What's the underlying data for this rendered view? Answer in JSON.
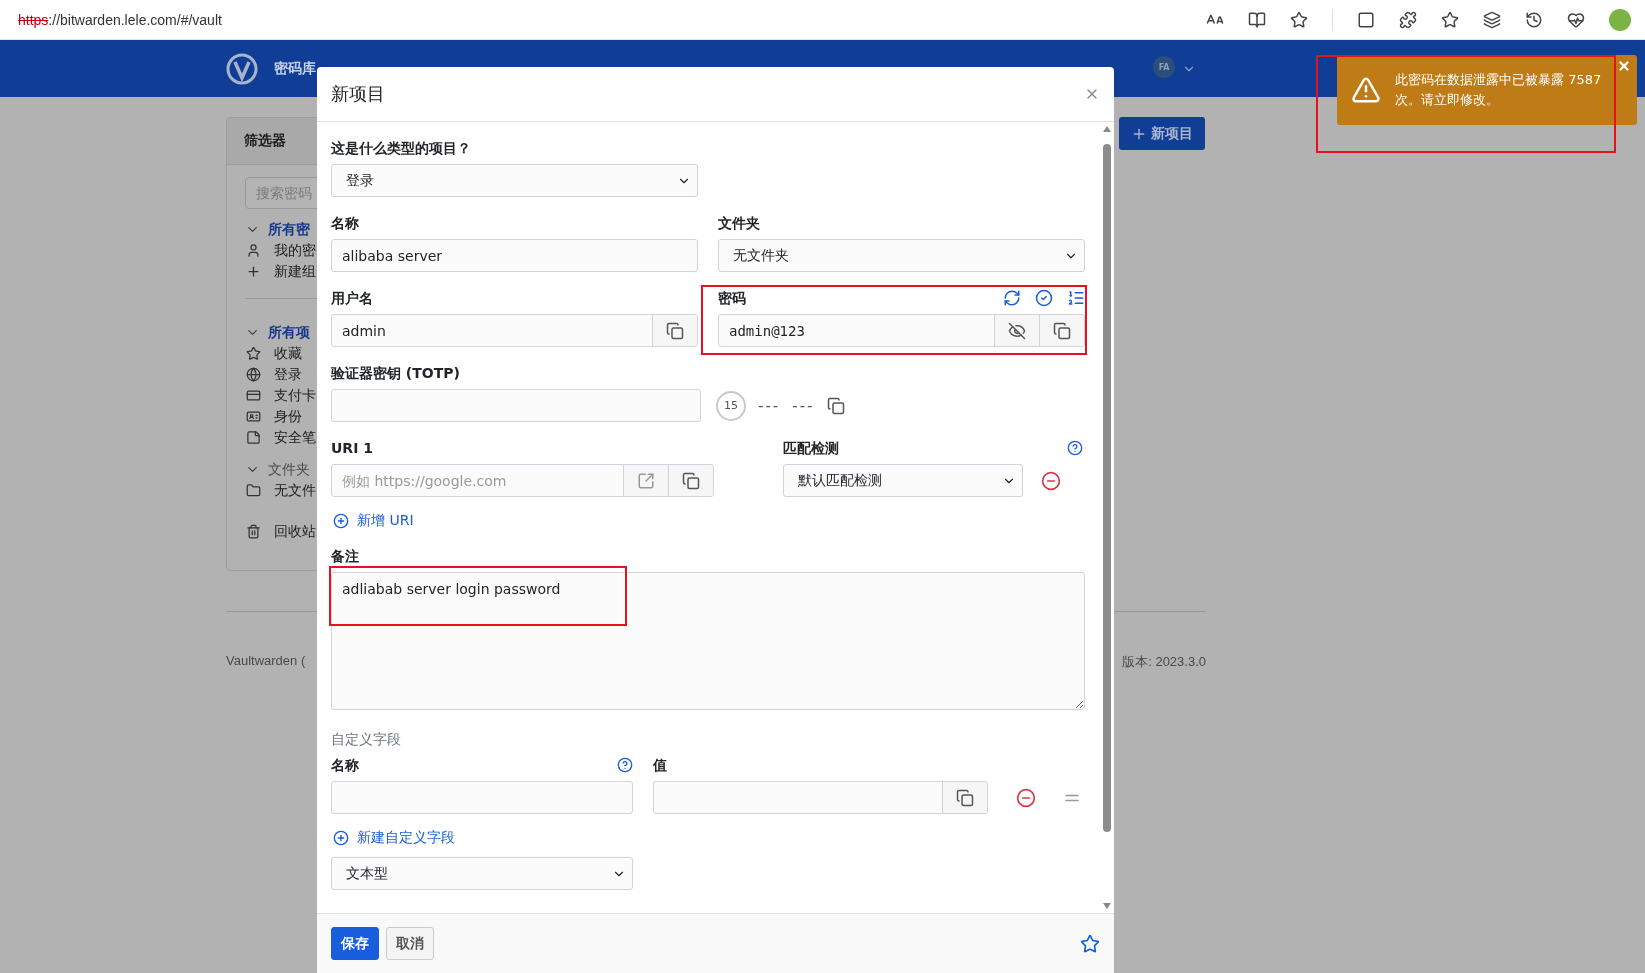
{
  "browser": {
    "url_scheme": "https",
    "url_rest": "://bitwarden.lele.com/#/vault"
  },
  "navbar": {
    "items": [
      {
        "label": "密码库",
        "selected": true
      }
    ],
    "avatar": "FA"
  },
  "sidebar": {
    "title": "筛选器",
    "search_placeholder": "搜索密码",
    "groups": [
      {
        "label": "所有密",
        "kind": "link",
        "expanded": true,
        "items": [
          {
            "label": "我的密",
            "kind": "person"
          },
          {
            "label": "新建组",
            "kind": "plus"
          }
        ]
      },
      {
        "label": "所有项",
        "kind": "link",
        "expanded": true,
        "items": [
          {
            "label": "收藏",
            "kind": "star"
          },
          {
            "label": "登录",
            "kind": "login"
          },
          {
            "label": "支付卡",
            "kind": "card"
          },
          {
            "label": "身份",
            "kind": "identity"
          },
          {
            "label": "安全笔",
            "kind": "note"
          }
        ]
      },
      {
        "label": "文件夹",
        "kind": "plain",
        "expanded": true,
        "items": [
          {
            "label": "无文件",
            "kind": "folder"
          }
        ]
      }
    ],
    "trash": {
      "label": "回收站",
      "kind": "trash"
    }
  },
  "new_item_button": "新项目",
  "footer": {
    "left": "Vaultwarden (",
    "right": "版本: 2023.3.0"
  },
  "modal": {
    "title": "新项目",
    "type": {
      "label": "这是什么类型的项目？",
      "value": "登录"
    },
    "name": {
      "label": "名称",
      "value": "alibaba server"
    },
    "folder": {
      "label": "文件夹",
      "value": "无文件夹"
    },
    "username": {
      "label": "用户名",
      "value": "admin"
    },
    "password": {
      "label": "密码",
      "value": "admin@123",
      "highlighted": true
    },
    "totp": {
      "label": "验证器密钥 (TOTP)",
      "timer": "15",
      "code": [
        "---",
        "---"
      ]
    },
    "uri": {
      "label": "URI 1",
      "placeholder": "例如 https://google.com",
      "match_label": "匹配检测",
      "match_value": "默认匹配检测"
    },
    "add_uri": "新增 URI",
    "notes": {
      "label": "备注",
      "value": "adliabab server login password",
      "highlighted": true
    },
    "custom_fields": {
      "heading": "自定义字段",
      "name_label": "名称",
      "value_label": "值",
      "add_label": "新建自定义字段",
      "type_value": "文本型"
    },
    "buttons": [
      {
        "label": "保存",
        "kind": "primary"
      },
      {
        "label": "取消",
        "kind": "secondary"
      }
    ],
    "favorite": false
  },
  "toast": {
    "message": "此密码在数据泄露中已被暴露 7587 次。请立即修改。",
    "highlighted": true
  }
}
